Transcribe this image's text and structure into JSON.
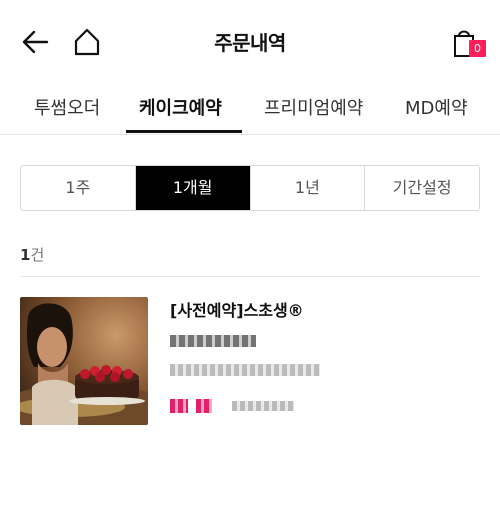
{
  "header": {
    "title": "주문내역",
    "cart_count": "0"
  },
  "tabs": [
    {
      "label": "투썸오더",
      "active": false
    },
    {
      "label": "케이크예약",
      "active": true
    },
    {
      "label": "프리미엄예약",
      "active": false
    },
    {
      "label": "MD예약",
      "active": false
    }
  ],
  "period": [
    {
      "label": "1주",
      "active": false
    },
    {
      "label": "1개월",
      "active": true
    },
    {
      "label": "1년",
      "active": false
    },
    {
      "label": "기간설정",
      "active": false
    }
  ],
  "summary": {
    "count_number": "1",
    "count_unit": "건"
  },
  "orders": [
    {
      "title": "[사전예약]스초생®"
    }
  ],
  "colors": {
    "accent": "#ff1f5a",
    "active_bg": "#000000",
    "text": "#111111"
  }
}
